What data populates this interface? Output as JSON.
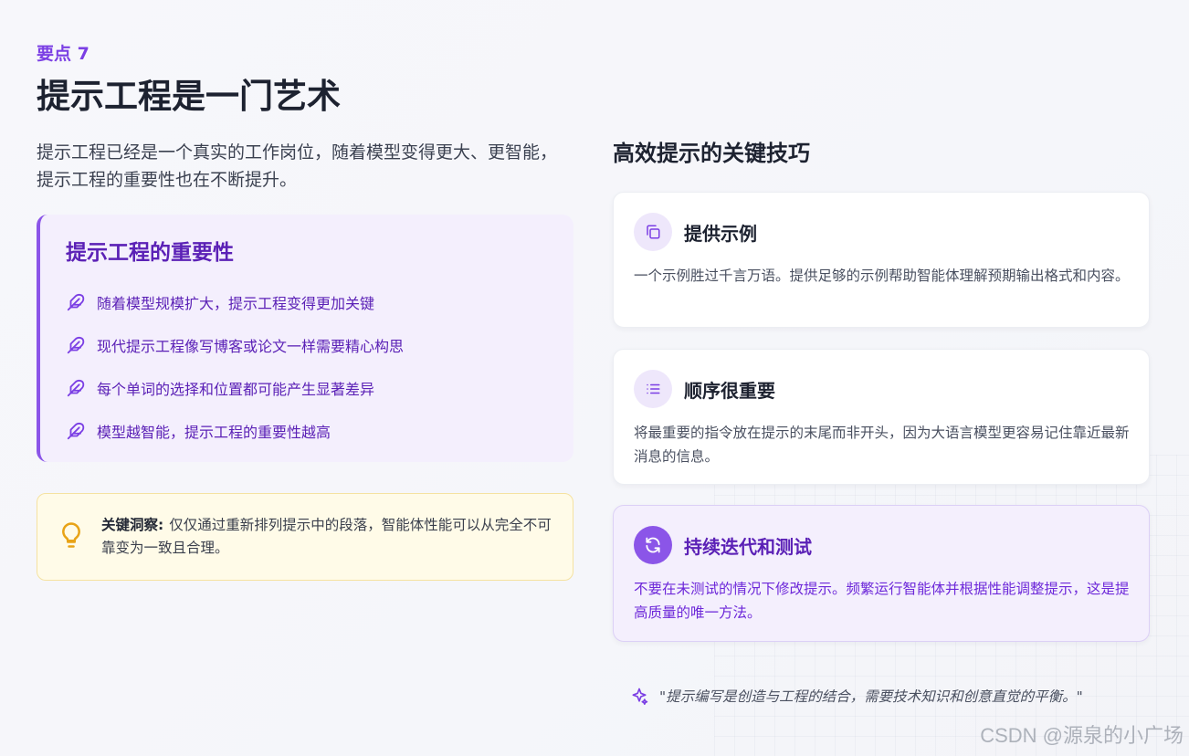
{
  "header": {
    "eyebrow": "要点 7",
    "title": "提示工程是一门艺术",
    "intro": "提示工程已经是一个真实的工作岗位，随着模型变得更大、更智能，提示工程的重要性也在不断提升。"
  },
  "importance": {
    "title": "提示工程的重要性",
    "icon": "feather-icon",
    "items": [
      "随着模型规模扩大，提示工程变得更加关键",
      "现代提示工程像写博客或论文一样需要精心构思",
      "每个单词的选择和位置都可能产生显著差异",
      "模型越智能，提示工程的重要性越高"
    ]
  },
  "insight": {
    "icon": "lightbulb-icon",
    "label": "关键洞察:",
    "text": "仅仅通过重新排列提示中的段落，智能体性能可以从完全不可靠变为一致且合理。"
  },
  "tips": {
    "title": "高效提示的关键技巧",
    "cards": [
      {
        "icon": "copy-icon",
        "title": "提供示例",
        "body": "一个示例胜过千言万语。提供足够的示例帮助智能体理解预期输出格式和内容。"
      },
      {
        "icon": "list-icon",
        "title": "顺序很重要",
        "body": "将最重要的指令放在提示的末尾而非开头，因为大语言模型更容易记住靠近最新消息的信息。"
      },
      {
        "icon": "refresh-icon",
        "title": "持续迭代和测试",
        "body": "不要在未测试的情况下修改提示。频繁运行智能体并根据性能调整提示，这是提高质量的唯一方法。"
      }
    ]
  },
  "quote": {
    "icon": "sparkle-icon",
    "text": "\"提示编写是创造与工程的结合，需要技术知识和创意直觉的平衡。\""
  },
  "watermark": "CSDN @源泉的小广场",
  "colors": {
    "accent": "#7b3fe4",
    "accent_dark": "#5b21b6",
    "accent_soft": "#f4effd",
    "insight_bg": "#fffbe8",
    "insight_icon": "#e8a317"
  }
}
